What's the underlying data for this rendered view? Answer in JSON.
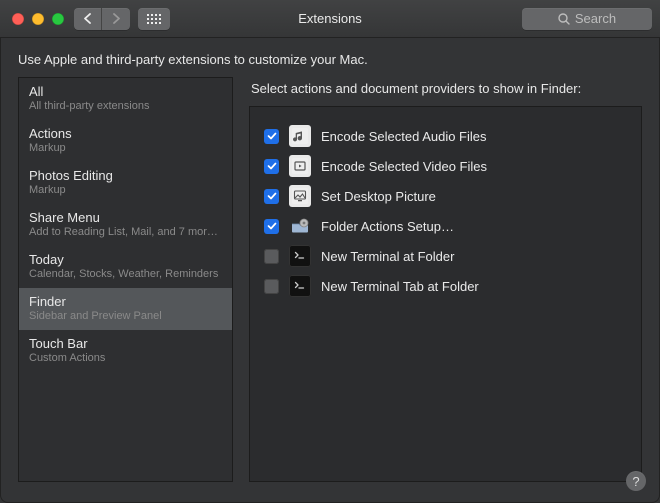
{
  "window": {
    "title": "Extensions",
    "search_placeholder": "Search"
  },
  "intro": "Use Apple and third-party extensions to customize your Mac.",
  "sidebar": {
    "items": [
      {
        "label": "All",
        "sub": "All third-party extensions"
      },
      {
        "label": "Actions",
        "sub": "Markup"
      },
      {
        "label": "Photos Editing",
        "sub": "Markup"
      },
      {
        "label": "Share Menu",
        "sub": "Add to Reading List, Mail, and 7 mor…"
      },
      {
        "label": "Today",
        "sub": "Calendar, Stocks, Weather, Reminders"
      },
      {
        "label": "Finder",
        "sub": "Sidebar and Preview Panel"
      },
      {
        "label": "Touch Bar",
        "sub": "Custom Actions"
      }
    ],
    "selected_index": 5
  },
  "detail": {
    "heading": "Select actions and document providers to show in Finder:",
    "rows": [
      {
        "checked": true,
        "icon": "audio",
        "label": "Encode Selected Audio Files"
      },
      {
        "checked": true,
        "icon": "video",
        "label": "Encode Selected Video Files"
      },
      {
        "checked": true,
        "icon": "picture",
        "label": "Set Desktop Picture"
      },
      {
        "checked": true,
        "icon": "folder",
        "label": "Folder Actions Setup…"
      },
      {
        "checked": false,
        "icon": "terminal",
        "label": "New Terminal at Folder"
      },
      {
        "checked": false,
        "icon": "terminal",
        "label": "New Terminal Tab at Folder"
      }
    ]
  },
  "help_label": "?"
}
